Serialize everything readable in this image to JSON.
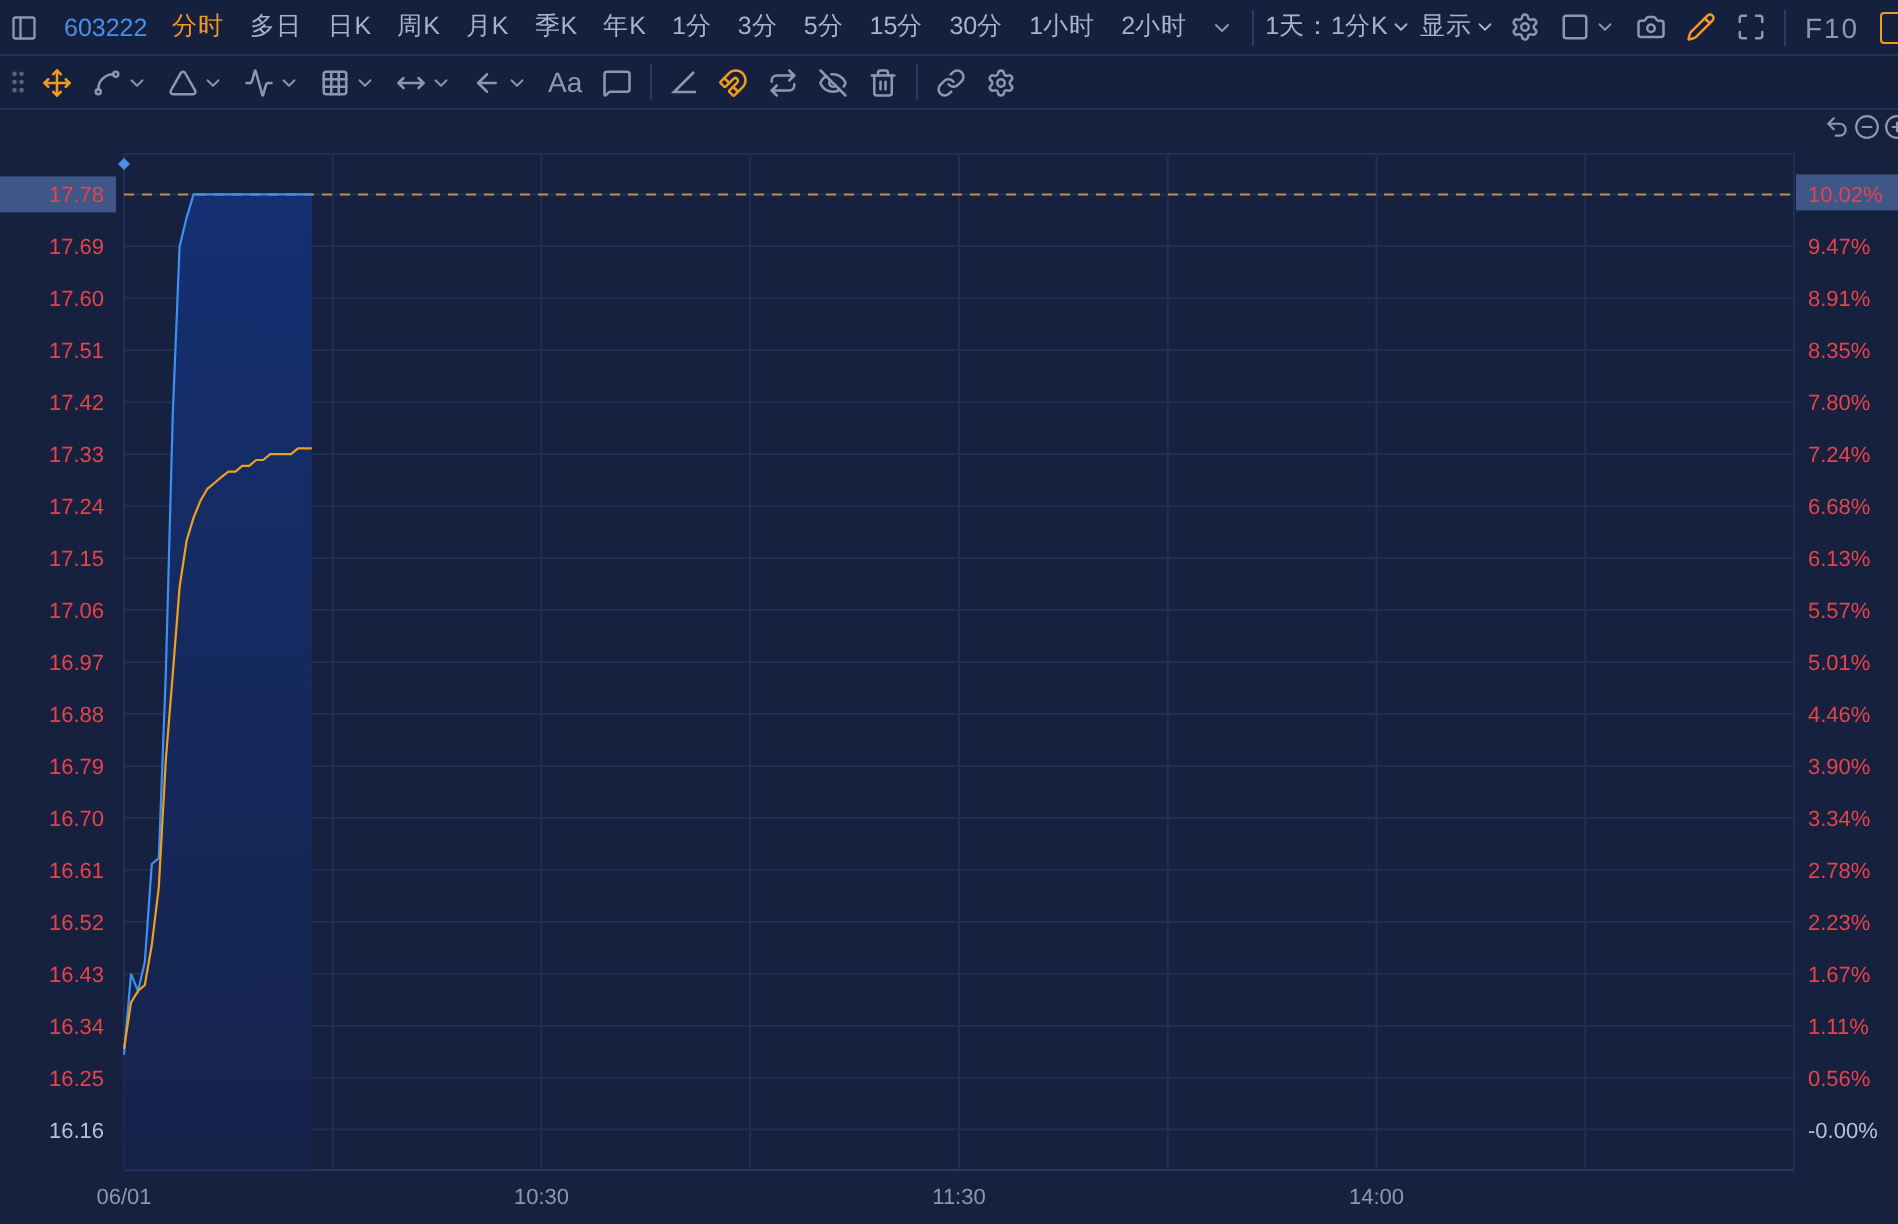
{
  "symbol": "603222",
  "timeframes": [
    {
      "label": "分时",
      "selected": true
    },
    {
      "label": "多日",
      "selected": false
    },
    {
      "label": "日K",
      "selected": false
    },
    {
      "label": "周K",
      "selected": false
    },
    {
      "label": "月K",
      "selected": false
    },
    {
      "label": "季K",
      "selected": false
    },
    {
      "label": "年K",
      "selected": false
    },
    {
      "label": "1分",
      "selected": false
    },
    {
      "label": "3分",
      "selected": false
    },
    {
      "label": "5分",
      "selected": false
    },
    {
      "label": "15分",
      "selected": false
    },
    {
      "label": "30分",
      "selected": false
    },
    {
      "label": "1小时",
      "selected": false
    },
    {
      "label": "2小时",
      "selected": false
    }
  ],
  "period_select": "1天：1分K",
  "display_select": "显示",
  "f10_label": "F10",
  "tools": [
    {
      "selected": true,
      "dropdown": false
    },
    {
      "selected": false,
      "dropdown": true
    },
    {
      "selected": false,
      "dropdown": true
    },
    {
      "selected": false,
      "dropdown": true
    },
    {
      "selected": false,
      "dropdown": true
    },
    {
      "selected": false,
      "dropdown": true
    },
    {
      "selected": false,
      "dropdown": true
    },
    {
      "selected": false,
      "dropdown": false,
      "label": "Aa"
    },
    {
      "selected": false,
      "dropdown": false
    },
    {
      "selected": false,
      "dropdown": false
    },
    {
      "selected": true,
      "dropdown": false
    },
    {
      "selected": false,
      "dropdown": false
    },
    {
      "selected": false,
      "dropdown": false
    },
    {
      "selected": false,
      "dropdown": false
    },
    {
      "selected": false,
      "dropdown": false
    },
    {
      "selected": false,
      "dropdown": false
    }
  ],
  "right_axis": [
    "10.02%",
    "9.47%",
    "8.91%",
    "8.35%",
    "7.80%",
    "7.24%",
    "6.68%",
    "6.13%",
    "5.57%",
    "5.01%",
    "4.46%",
    "3.90%",
    "3.34%",
    "2.78%",
    "2.23%",
    "1.67%",
    "1.11%",
    "0.56%",
    "-0.00%"
  ],
  "afternoon_tick": "14:00",
  "chart_data": {
    "type": "line",
    "grid": true,
    "x": [
      9.5,
      9.5167,
      9.5333,
      9.55,
      9.5667,
      9.5833,
      9.6,
      9.6167,
      9.6333,
      9.65,
      9.6667,
      9.6833,
      9.7,
      9.7167,
      9.7333,
      9.75,
      9.7667,
      9.7833,
      9.8,
      9.8167,
      9.8333,
      9.85,
      9.8667,
      9.8833,
      9.9,
      9.9167,
      9.9333,
      9.95
    ],
    "xlim": [
      9.5,
      13.5
    ],
    "ylim": [
      16.09,
      17.85
    ],
    "xticks": [
      {
        "value": 9.5,
        "label": "06/01"
      },
      {
        "value": 10.5,
        "label": "10:30"
      },
      {
        "value": 11.5,
        "label": "11:30"
      }
    ],
    "ref_lines": [
      {
        "axis": "y",
        "value": 17.78,
        "color": "#d08a3a"
      }
    ],
    "yticks": [
      {
        "value": 17.78,
        "label": "17.78"
      },
      {
        "value": 17.69,
        "label": "17.69"
      },
      {
        "value": 17.6,
        "label": "17.60"
      },
      {
        "value": 17.51,
        "label": "17.51"
      },
      {
        "value": 17.42,
        "label": "17.42"
      },
      {
        "value": 17.33,
        "label": "17.33"
      },
      {
        "value": 17.24,
        "label": "17.24"
      },
      {
        "value": 17.15,
        "label": "17.15"
      },
      {
        "value": 17.06,
        "label": "17.06"
      },
      {
        "value": 16.97,
        "label": "16.97"
      },
      {
        "value": 16.88,
        "label": "16.88"
      },
      {
        "value": 16.79,
        "label": "16.79"
      },
      {
        "value": 16.7,
        "label": "16.70"
      },
      {
        "value": 16.61,
        "label": "16.61"
      },
      {
        "value": 16.52,
        "label": "16.52"
      },
      {
        "value": 16.43,
        "label": "16.43"
      },
      {
        "value": 16.34,
        "label": "16.34"
      },
      {
        "value": 16.25,
        "label": "16.25"
      },
      {
        "value": 16.16,
        "label": "16.16"
      }
    ],
    "series": [
      {
        "color": "#3f8ff0",
        "values": [
          16.29,
          16.43,
          16.4,
          16.45,
          16.62,
          16.63,
          16.95,
          17.4,
          17.69,
          17.74,
          17.78,
          17.78,
          17.78,
          17.78,
          17.78,
          17.78,
          17.78,
          17.78,
          17.78,
          17.78,
          17.78,
          17.78,
          17.78,
          17.78,
          17.78,
          17.78,
          17.78,
          17.78
        ]
      },
      {
        "color": "#f0a020",
        "values": [
          16.3,
          16.38,
          16.4,
          16.41,
          16.48,
          16.58,
          16.8,
          16.95,
          17.1,
          17.18,
          17.22,
          17.25,
          17.27,
          17.28,
          17.29,
          17.3,
          17.3,
          17.31,
          17.31,
          17.32,
          17.32,
          17.33,
          17.33,
          17.33,
          17.33,
          17.34,
          17.34,
          17.34
        ]
      }
    ]
  }
}
